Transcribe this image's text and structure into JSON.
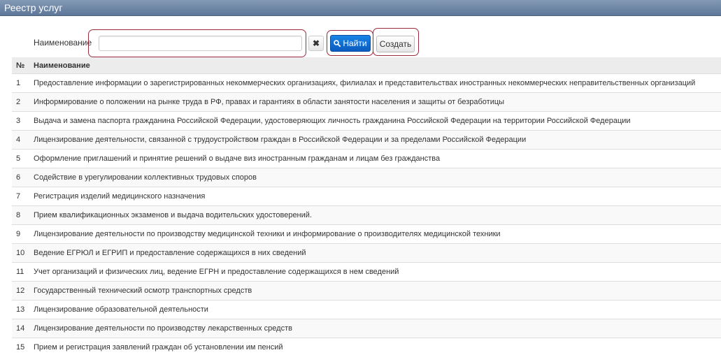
{
  "window": {
    "title": "Реестр услуг"
  },
  "search": {
    "label": "Наименование",
    "value": "",
    "placeholder": "",
    "clear_icon": "✖",
    "find_label": "Найти",
    "create_label": "Создать"
  },
  "table": {
    "headers": {
      "num": "№",
      "name": "Наименование"
    },
    "rows": [
      {
        "num": "1",
        "name": "Предоставление информации о зарегистрированных некоммерческих организациях, филиалах и представительствах иностранных некоммерческих неправительственных организаций"
      },
      {
        "num": "2",
        "name": "Информирование о положении на рынке труда в РФ, правах и гарантиях в области занятости населения и защиты от безработицы"
      },
      {
        "num": "3",
        "name": "Выдача и замена паспорта гражданина Российской Федерации, удостоверяющих личность гражданина Российской Федерации на территории Российской Федерации"
      },
      {
        "num": "4",
        "name": "Лицензирование деятельности, связанной с трудоустройством граждан в Российской Федерации и за пределами Российской Федерации"
      },
      {
        "num": "5",
        "name": "Оформление приглашений и принятие решений о выдаче виз иностранным гражданам и лицам без гражданства"
      },
      {
        "num": "6",
        "name": "Содействие в урегулировании коллективных трудовых споров"
      },
      {
        "num": "7",
        "name": "Регистрация изделий медицинского назначения"
      },
      {
        "num": "8",
        "name": "Прием квалификационных экзаменов и выдача водительских удостоверений."
      },
      {
        "num": "9",
        "name": "Лицензирование деятельности по производству медицинской техники и информирование о производителях медицинской техники"
      },
      {
        "num": "10",
        "name": "Ведение ЕГРЮЛ и ЕГРИП и предоставление содержащихся в них сведений"
      },
      {
        "num": "11",
        "name": "Учет организаций и физических лиц, ведение ЕГРН и предоставление содержащихся в нем сведений"
      },
      {
        "num": "12",
        "name": "Государственный технический осмотр транспортных средств"
      },
      {
        "num": "13",
        "name": "Лицензирование образовательной деятельности"
      },
      {
        "num": "14",
        "name": "Лицензирование деятельности по производству лекарственных средств"
      },
      {
        "num": "15",
        "name": "Прием и регистрация заявлений граждан об установлении им пенсий"
      }
    ]
  },
  "colors": {
    "titlebar": "#6a82a5",
    "primary_button": "#0b6fd6",
    "highlight_border": "#9c2b3d"
  }
}
